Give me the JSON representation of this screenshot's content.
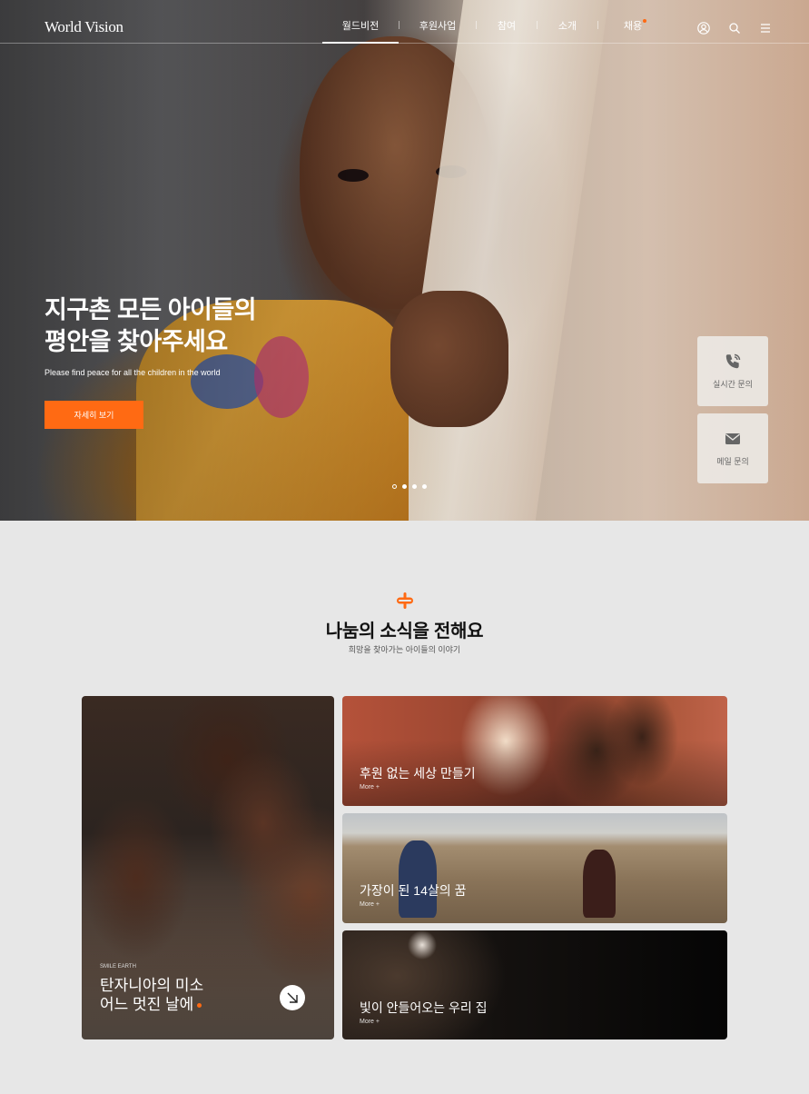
{
  "brand": {
    "logo": "World Vision",
    "accent": "#ff6a13"
  },
  "nav": {
    "items": [
      {
        "label": "월드비전",
        "active": true
      },
      {
        "label": "후원사업",
        "active": false
      },
      {
        "label": "참여",
        "active": false
      },
      {
        "label": "소개",
        "active": false
      },
      {
        "label": "채용",
        "active": false,
        "new_dot": true
      }
    ],
    "icons": [
      "user-icon",
      "search-icon",
      "hamburger-icon"
    ]
  },
  "hero": {
    "title_line1": "지구촌 모든 아이들의",
    "title_line2": "평안을 찾아주세요",
    "subtitle": "Please find peace for all the children in the world",
    "button": "자세히 보기",
    "slides": 4,
    "current_slide": 1
  },
  "floating": {
    "chat": {
      "label": "실시간 문의",
      "icon": "phone-chat-icon"
    },
    "mail": {
      "label": "메일 문의",
      "icon": "mail-icon"
    }
  },
  "news": {
    "title": "나눔의 소식을 전해요",
    "subtitle": "희망을 찾아가는 아이들의 이야기",
    "feature": {
      "tag": "SMILE EARTH",
      "line1": "탄자니아의 미소",
      "line2": "어느 멋진 날에"
    },
    "cards": [
      {
        "title": "후원 없는 세상 만들기",
        "more": "More +"
      },
      {
        "title": "가장이 된 14살의 꿈",
        "more": "More +"
      },
      {
        "title": "빛이 안들어오는 우리 집",
        "more": "More +"
      }
    ]
  }
}
